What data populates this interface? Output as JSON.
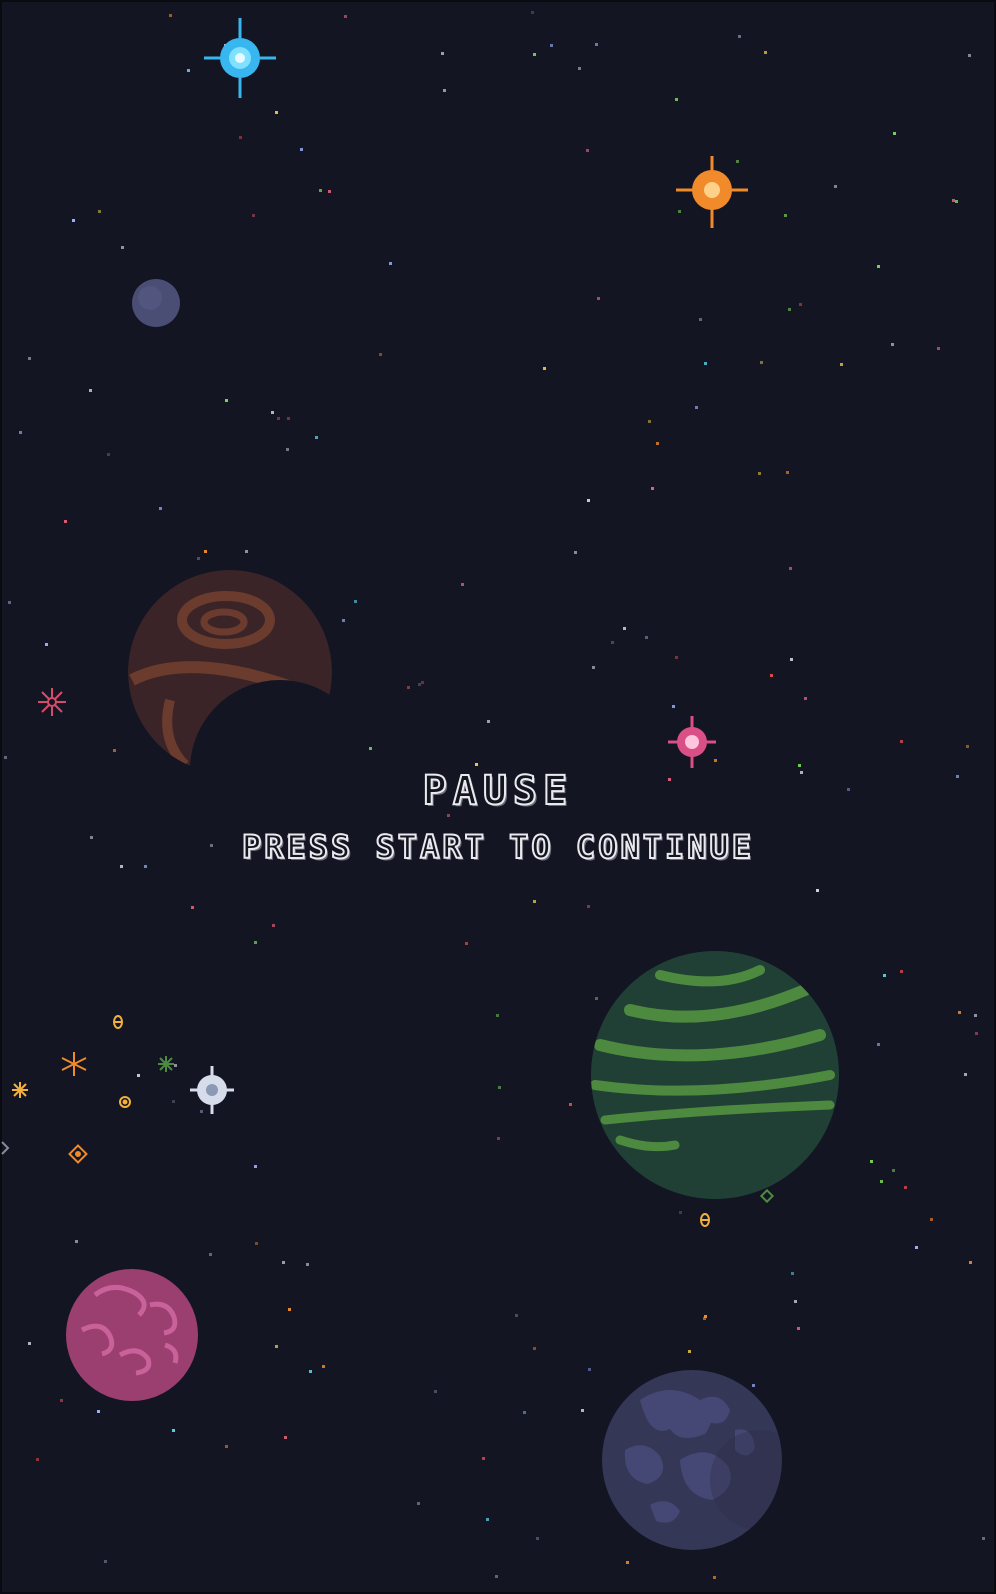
{
  "game": {
    "pause_title": "PAUSE",
    "pause_subtitle": "PRESS START TO CONTINUE"
  },
  "colors": {
    "background": "#131522",
    "text": "#e9e9ef"
  },
  "scene": {
    "planets": [
      {
        "name": "small-gray-moon",
        "color": "#4a4d74"
      },
      {
        "name": "brown-swirl-planet",
        "color": "#3b2428"
      },
      {
        "name": "green-banded-planet",
        "color": "#214035"
      },
      {
        "name": "pink-swirl-planet",
        "color": "#9a3f6f"
      },
      {
        "name": "purple-cratered-planet",
        "color": "#353757"
      }
    ],
    "sparkles": [
      {
        "name": "blue-star-icon",
        "color": "#37b6f0"
      },
      {
        "name": "orange-star-icon",
        "color": "#f08a2a"
      },
      {
        "name": "pink-star-icon",
        "color": "#d94f86"
      },
      {
        "name": "white-star-icon",
        "color": "#d7dcea"
      }
    ]
  }
}
